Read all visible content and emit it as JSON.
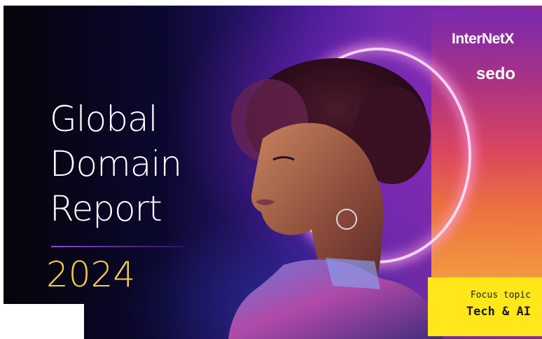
{
  "cover": {
    "title_lines": [
      "Global",
      "Domain",
      "Report"
    ],
    "year": "2024"
  },
  "logos": {
    "internetx": "InterNetX",
    "sedo": "sedo"
  },
  "focus": {
    "label": "Focus topic",
    "value": "Tech & AI"
  },
  "colors": {
    "year_yellow": "#f4d23c",
    "focus_box_yellow": "#ffe71a",
    "background_purple": "#4b1e9a"
  }
}
